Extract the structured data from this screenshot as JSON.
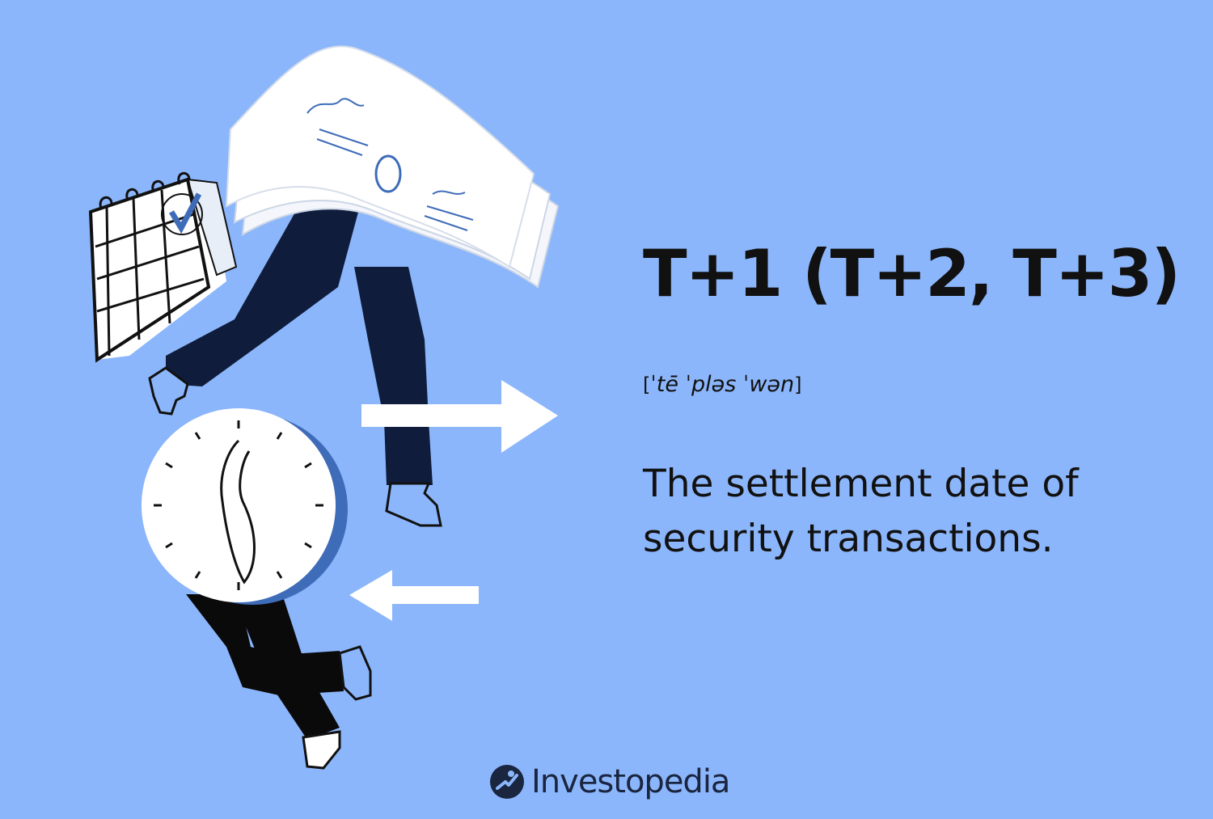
{
  "term": {
    "title": "T+1 (T+2, T+3)",
    "pronunciation": "ˈtē ˈpləs ˈwən",
    "bracket_open": "[",
    "bracket_close": "]",
    "definition": "The settlement date of security transactions."
  },
  "brand": {
    "name": "Investopedia",
    "logo_icon": "investopedia-logo-icon"
  },
  "illustration": {
    "elements": [
      "calendar-icon",
      "banknote-stack",
      "clock-icon",
      "arrow-right-icon",
      "arrow-left-icon",
      "running-figure"
    ]
  },
  "colors": {
    "background": "#8cb6fb",
    "navy": "#0f1c3b",
    "white": "#ffffff",
    "ink": "#111111",
    "accent_blue": "#3f6cb8"
  }
}
